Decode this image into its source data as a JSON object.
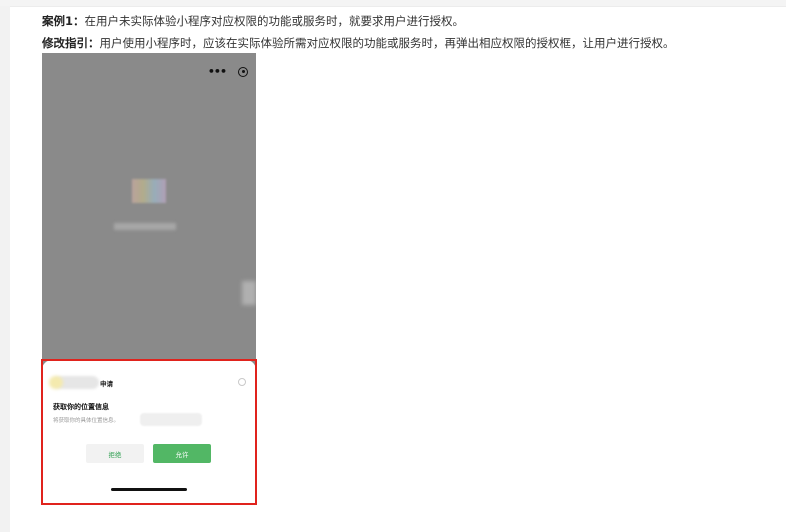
{
  "instructions": {
    "case_label": "案例1：",
    "case_text": "在用户未实际体验小程序对应权限的功能或服务时，就要求用户进行授权。",
    "guide_label": "修改指引：",
    "guide_text": "用户使用小程序时，应该在实际体验所需对应权限的功能或服务时，再弹出相应权限的授权框，让用户进行授权。"
  },
  "phone": {
    "capsule": {
      "more_icon": "more-dots-icon",
      "close_icon": "close-target-icon",
      "more_glyph": "•••"
    },
    "permission_sheet": {
      "apply_label": "申请",
      "permission_title": "获取你的位置信息",
      "permission_desc": "将获取你的具体位置信息。",
      "reject_label": "拒绝",
      "allow_label": "允许",
      "info_icon": "info-icon"
    }
  },
  "colors": {
    "highlight_frame": "#e0231d",
    "allow_button": "#52b765",
    "reject_text": "#2e9f50",
    "overlay": "#8a8a8a"
  }
}
